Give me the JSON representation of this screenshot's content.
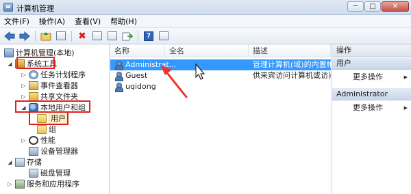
{
  "window": {
    "title": "计算机管理",
    "icon": "computer-management-icon",
    "buttons": {
      "minimize": "─",
      "maximize": "□",
      "close": "✕"
    }
  },
  "menu": {
    "items": [
      "文件(F)",
      "操作(A)",
      "查看(V)",
      "帮助(H)"
    ]
  },
  "toolbar": {
    "icons": [
      "back-arrow-icon",
      "forward-arrow-icon",
      "up-folder-icon",
      "show-hide-tree-icon",
      "delete-icon",
      "properties-icon",
      "refresh-icon",
      "export-icon",
      "help-icon",
      "console-icon"
    ],
    "delete_glyph": "✖",
    "help_glyph": "?"
  },
  "tree": {
    "root": "计算机管理(本地)",
    "items": [
      {
        "label": "系统工具",
        "expander": "◢",
        "icon": "tools-icon"
      },
      {
        "label": "任务计划程序",
        "expander": "▷",
        "icon": "clock-icon"
      },
      {
        "label": "事件查看器",
        "expander": "▷",
        "icon": "event-viewer-icon"
      },
      {
        "label": "共享文件夹",
        "expander": "▷",
        "icon": "shared-folder-icon"
      },
      {
        "label": "本地用户和组",
        "expander": "◢",
        "icon": "users-icon"
      },
      {
        "label": "用户",
        "expander": "",
        "icon": "folder-icon"
      },
      {
        "label": "组",
        "expander": "",
        "icon": "folder-icon"
      },
      {
        "label": "性能",
        "expander": "▷",
        "icon": "performance-icon"
      },
      {
        "label": "设备管理器",
        "expander": "",
        "icon": "device-manager-icon"
      },
      {
        "label": "存储",
        "expander": "◢",
        "icon": "storage-icon"
      },
      {
        "label": "磁盘管理",
        "expander": "",
        "icon": "disk-icon"
      },
      {
        "label": "服务和应用程序",
        "expander": "▷",
        "icon": "services-icon"
      }
    ]
  },
  "list": {
    "columns": [
      "名称",
      "全名",
      "描述"
    ],
    "rows": [
      {
        "name": "Administrat...",
        "full_name": "",
        "description": "管理计算机(域)的内置帐户"
      },
      {
        "name": "Guest",
        "full_name": "",
        "description": "供来宾访问计算机或访问域的内..."
      },
      {
        "name": "uqidong",
        "full_name": "",
        "description": ""
      }
    ]
  },
  "actions": {
    "header": "操作",
    "sections": [
      {
        "title": "用户",
        "items": [
          "更多操作"
        ]
      },
      {
        "title": "Administrator",
        "items": [
          "更多操作"
        ]
      }
    ]
  },
  "colors": {
    "selection": "#3399ff",
    "highlight_box": "#e02020",
    "annotation_arrow": "#e8342c"
  }
}
